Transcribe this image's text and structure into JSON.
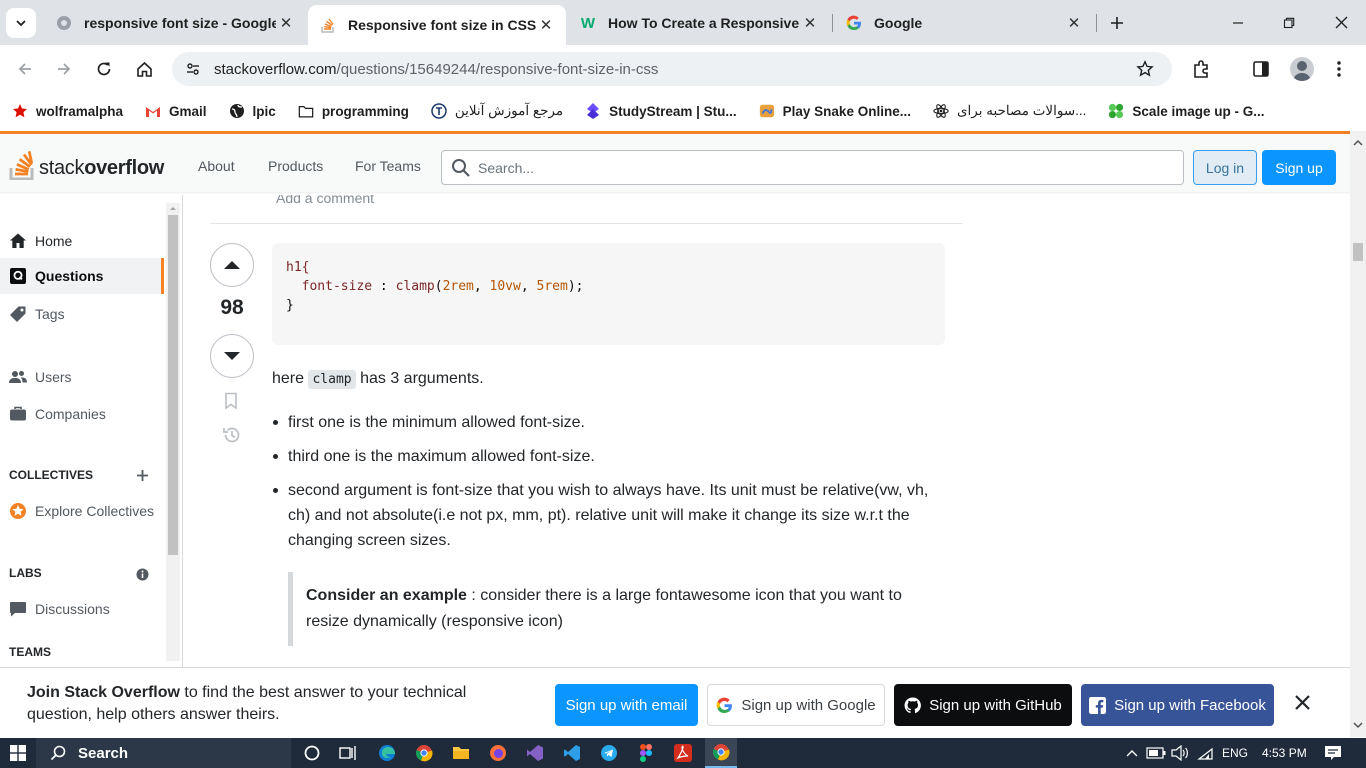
{
  "browser": {
    "tabs": [
      {
        "title": "responsive font size - Google",
        "icon": "google-favicon"
      },
      {
        "title": "Responsive font size in CSS - S",
        "icon": "stackoverflow-favicon"
      },
      {
        "title": "How To Create a Responsive T",
        "icon": "w3schools-favicon"
      },
      {
        "title": "Google",
        "icon": "google-favicon"
      }
    ],
    "url_host": "stackoverflow.com",
    "url_path": "/questions/15649244/responsive-font-size-in-css",
    "bookmarks": [
      {
        "label": "wolframalpha",
        "icon": "wolfram-icon"
      },
      {
        "label": "Gmail",
        "icon": "gmail-icon"
      },
      {
        "label": "lpic",
        "icon": "globe-icon"
      },
      {
        "label": "programming",
        "icon": "folder-icon"
      },
      {
        "label": "مرجع آموزش آنلاین",
        "icon": "tutorial-icon"
      },
      {
        "label": "StudyStream | Stu...",
        "icon": "studystream-icon"
      },
      {
        "label": "Play Snake Online...",
        "icon": "snake-icon"
      },
      {
        "label": "سوالات مصاحبه برای...",
        "icon": "react-icon"
      },
      {
        "label": "Scale image up - G...",
        "icon": "scale-icon"
      }
    ]
  },
  "so_header": {
    "logo_word1": "stack",
    "logo_word2": "overflow",
    "nav": [
      "About",
      "Products",
      "For Teams"
    ],
    "search_placeholder": "Search...",
    "login": "Log in",
    "signup": "Sign up"
  },
  "sidebar": {
    "home": "Home",
    "questions": "Questions",
    "tags": "Tags",
    "users": "Users",
    "companies": "Companies",
    "collectives_head": "COLLECTIVES",
    "explore_collectives": "Explore Collectives",
    "labs_head": "LABS",
    "discussions": "Discussions",
    "teams_head": "TEAMS"
  },
  "answer": {
    "add_comment": "Add a comment",
    "votes": "98",
    "code_lines": [
      "h1{",
      "  font-size : clamp(2rem, 10vw, 5rem);",
      "}"
    ],
    "intro_before": "here",
    "intro_code": "clamp",
    "intro_after": "has 3 arguments.",
    "bullets": [
      "first one is the minimum allowed font-size.",
      "third one is the maximum allowed font-size.",
      "second argument is font-size that you wish to always have. Its unit must be relative(vw, vh, ch) and not absolute(i.e not px, mm, pt). relative unit will make it change its size w.r.t the changing screen sizes."
    ],
    "quote_bold": "Consider an example",
    "quote_rest": " : consider there is a large fontawesome icon that you want to resize dynamically (responsive icon)"
  },
  "banner": {
    "bold": "Join Stack Overflow",
    "rest": " to find the best answer to your technical question, help others answer theirs.",
    "email": "Sign up with email",
    "google": "Sign up with Google",
    "github": "Sign up with GitHub",
    "facebook": "Sign up with Facebook"
  },
  "taskbar": {
    "search": "Search",
    "lang": "ENG",
    "time": "4:53 PM"
  },
  "colors": {
    "so_orange": "#f48225",
    "so_blue": "#0a95ff",
    "github_black": "#0c0d0e",
    "facebook_blue": "#385499",
    "taskbar": "#1f2b3a"
  }
}
